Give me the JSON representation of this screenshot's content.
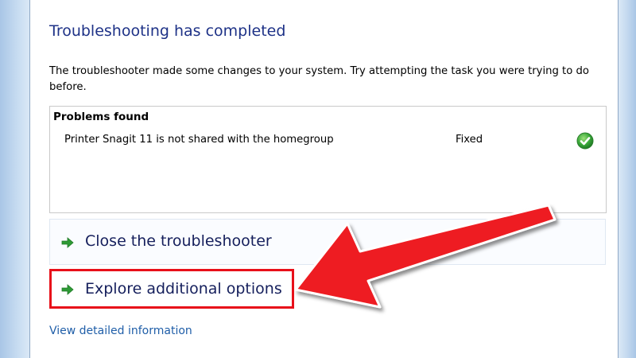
{
  "heading": "Troubleshooting has completed",
  "description": "The troubleshooter made some changes to your system. Try attempting the task you were trying to do before.",
  "problems": {
    "title": "Problems found",
    "rows": [
      {
        "description": "Printer Snagit 11 is not shared with the homegroup",
        "status": "Fixed",
        "status_icon": "green-check-icon"
      }
    ]
  },
  "options": {
    "close_label": "Close the troubleshooter",
    "explore_label": "Explore additional options"
  },
  "details_link": "View detailed information",
  "colors": {
    "heading": "#1e3287",
    "link": "#1f5ea8",
    "highlight": "#e8101a",
    "option_arrow": "#2e9a35",
    "frame": "#b9d1ea"
  }
}
